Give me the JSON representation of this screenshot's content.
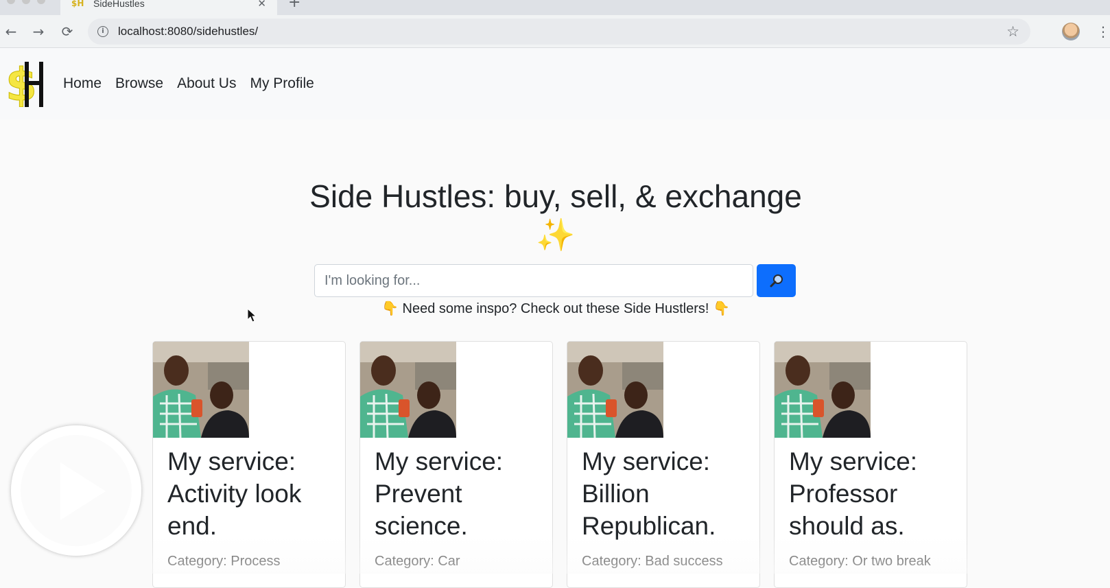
{
  "browser": {
    "tab_title": "SideHustles",
    "tab_close_icon": "close-icon",
    "url": "localhost:8080/sidehustles/",
    "back_icon": "←",
    "forward_icon": "→",
    "reload_icon": "⟳",
    "info_icon": "i",
    "star_icon": "☆",
    "menu_icon": "⋮",
    "new_tab_icon": "+"
  },
  "site": {
    "logo": {
      "letters": "$H",
      "accent_color": "#f5e642"
    },
    "nav": [
      "Home",
      "Browse",
      "About Us",
      "My Profile"
    ],
    "hero_title": "Side Hustles: buy, sell, & exchange ✨",
    "search_placeholder": "I'm looking for...",
    "search_icon": "magnifying-glass-icon",
    "hint_text": "Need some inspo? Check out these Side Hustlers!",
    "hint_emoji": "👇"
  },
  "cards": [
    {
      "title": "My service: Activity look end.",
      "category_label": "Category:",
      "category": "Process"
    },
    {
      "title": "My service: Prevent science.",
      "category_label": "Category:",
      "category": "Car"
    },
    {
      "title": "My service: Billion Republican.",
      "category_label": "Category:",
      "category": "Bad success"
    },
    {
      "title": "My service: Professor should as.",
      "category_label": "Category:",
      "category": "Or two break"
    }
  ],
  "colors": {
    "primary": "#0d6efd",
    "navbar_bg": "#f8f9fa",
    "page_bg": "#fafafa",
    "text": "#212529"
  }
}
